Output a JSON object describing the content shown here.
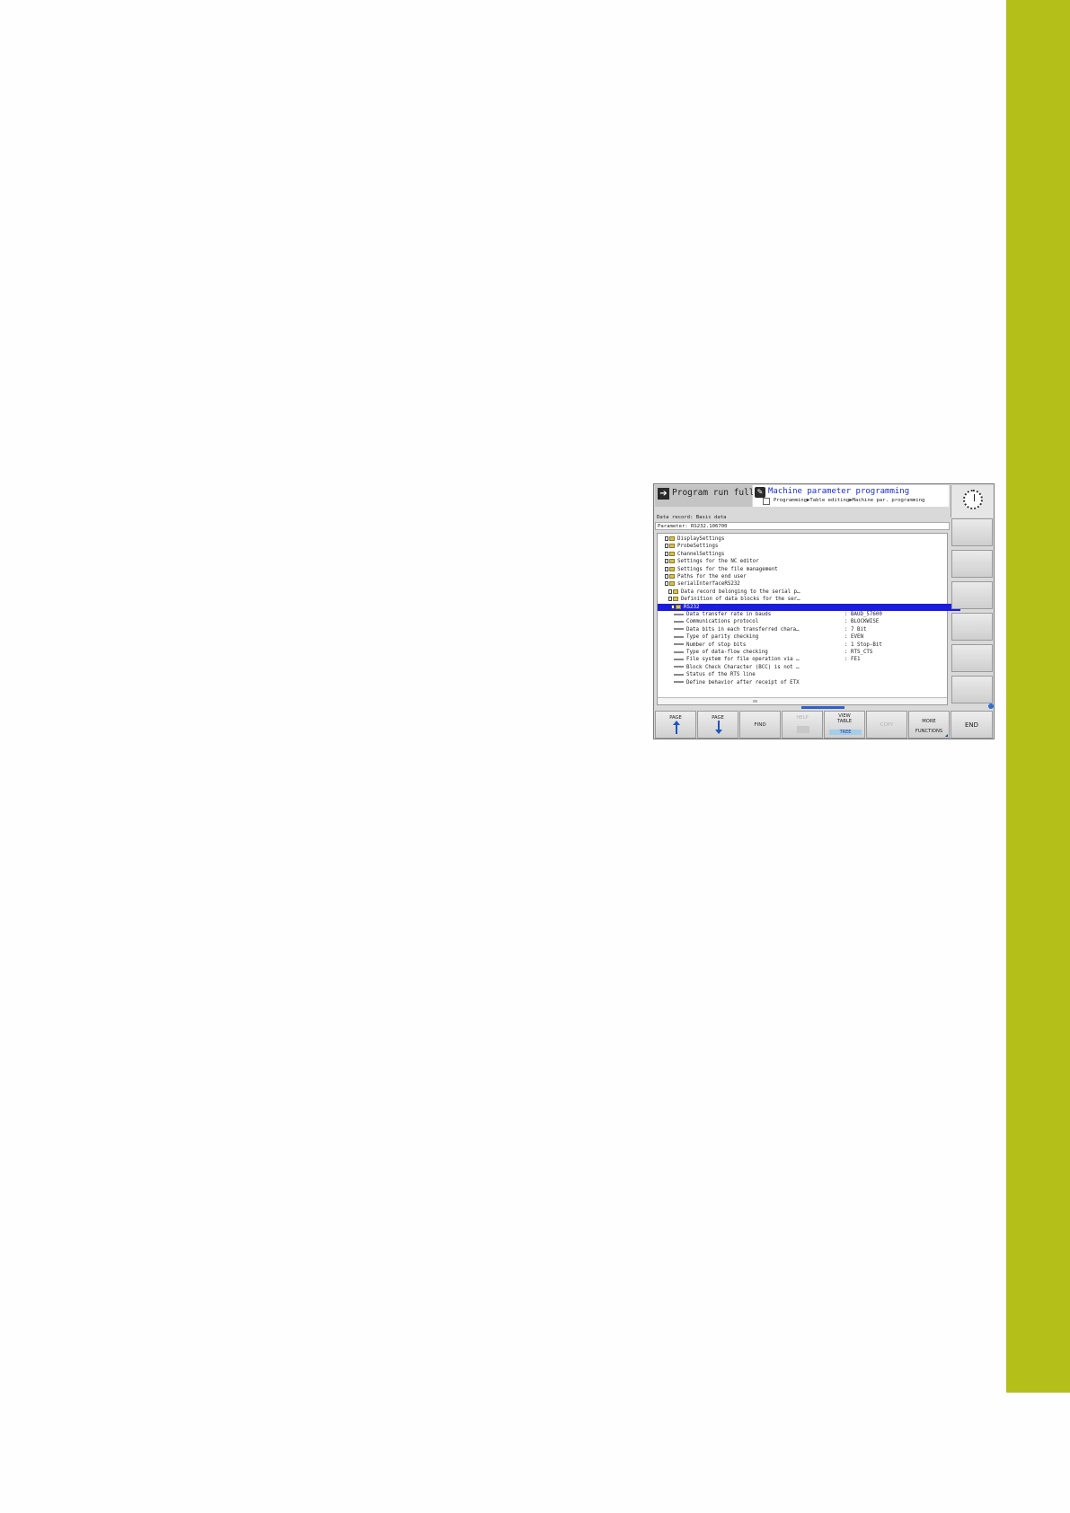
{
  "header": {
    "mode_label": "Program run full…",
    "title": "Machine parameter programming",
    "breadcrumb": "Programming▶Table editing▶Machine par. programming"
  },
  "info": {
    "data_record": "Data record: Basic data",
    "parameter": "Parameter: RS232.106700"
  },
  "tree": [
    {
      "label": "DisplaySettings"
    },
    {
      "label": "ProbeSettings"
    },
    {
      "label": "ChannelSettings"
    },
    {
      "label": "Settings for the NC editor"
    },
    {
      "label": "Settings for the file management"
    },
    {
      "label": "Paths for the end user"
    },
    {
      "label": "serialInterfaceRS232"
    },
    {
      "label": "Data record belonging to the serial p…"
    },
    {
      "label": "Definition of data blocks for the ser…"
    },
    {
      "label": "RS232"
    },
    {
      "label": "Data transfer rate in bauds",
      "value": ": BAUD_57600"
    },
    {
      "label": "Communications protocol",
      "value": ": BLOCKWISE"
    },
    {
      "label": "Data bits in each transferred chara…",
      "value": ": 7 Bit"
    },
    {
      "label": "Type of parity checking",
      "value": ": EVEN"
    },
    {
      "label": "Number of stop bits",
      "value": ": 1 Stop-Bit"
    },
    {
      "label": "Type of data-flow checking",
      "value": ": RTS_CTS"
    },
    {
      "label": "File system for file operation via …",
      "value": ": FE1"
    },
    {
      "label": "Block Check Character (BCC) is not …"
    },
    {
      "label": "Status of the RTS line"
    },
    {
      "label": "Define behavior after receipt of ETX"
    }
  ],
  "softkeys": {
    "page_up": "PAGE",
    "page_down": "PAGE",
    "find": "FIND",
    "disabled1": "HELP",
    "view_table": "VIEW\nTABLE",
    "tree_tag": "TREE",
    "disabled2": "COPY",
    "more_functions": "MORE\nFUNCTIONS",
    "end": "END"
  },
  "colors": {
    "side_tab": "#b5bf1a",
    "title_blue": "#1a2ccf",
    "selection": "#1c1ce0"
  }
}
